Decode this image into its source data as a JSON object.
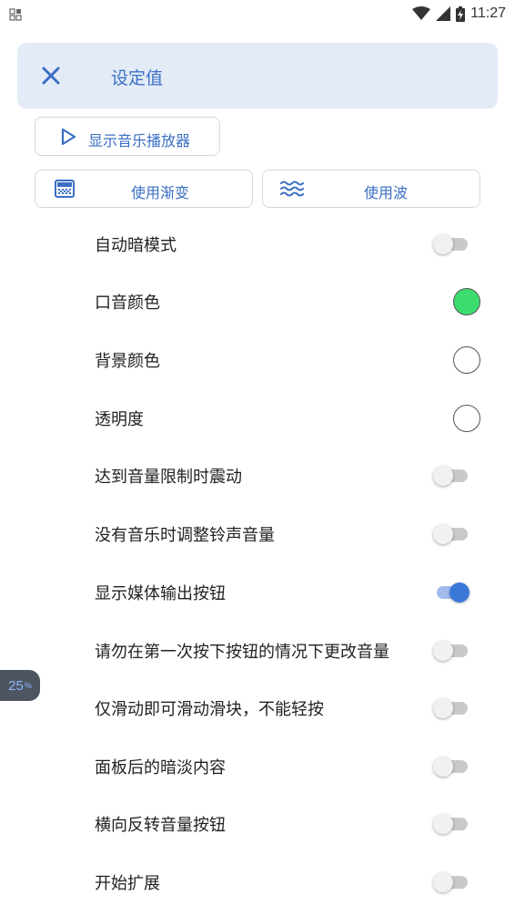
{
  "status_bar": {
    "time": "11:27"
  },
  "header": {
    "title": "设定值"
  },
  "buttons": {
    "show_player": "显示音乐播放器",
    "use_gradient": "使用渐变",
    "use_wave": "使用波"
  },
  "colors": {
    "accent": "#3a6fc4",
    "accent_color_swatch": "#3ddc6f",
    "switch_on": "#3a78d8"
  },
  "settings": [
    {
      "label": "自动暗模式",
      "type": "switch",
      "on": false
    },
    {
      "label": "口音颜色",
      "type": "color",
      "color": "#3ddc6f"
    },
    {
      "label": "背景颜色",
      "type": "color",
      "color": "#ffffff"
    },
    {
      "label": "透明度",
      "type": "color",
      "color": "#ffffff"
    },
    {
      "label": "达到音量限制时震动",
      "type": "switch",
      "on": false
    },
    {
      "label": "没有音乐时调整铃声音量",
      "type": "switch",
      "on": false
    },
    {
      "label": "显示媒体输出按钮",
      "type": "switch",
      "on": true
    },
    {
      "label": "请勿在第一次按下按钮的情况下更改音量",
      "type": "switch",
      "on": false
    },
    {
      "label": "仅滑动即可滑动滑块，不能轻按",
      "type": "switch",
      "on": false
    },
    {
      "label": "面板后的暗淡内容",
      "type": "switch",
      "on": false
    },
    {
      "label": "横向反转音量按钮",
      "type": "switch",
      "on": false
    },
    {
      "label": "开始扩展",
      "type": "switch",
      "on": false
    }
  ],
  "badge": {
    "value": "25",
    "unit": "%"
  }
}
